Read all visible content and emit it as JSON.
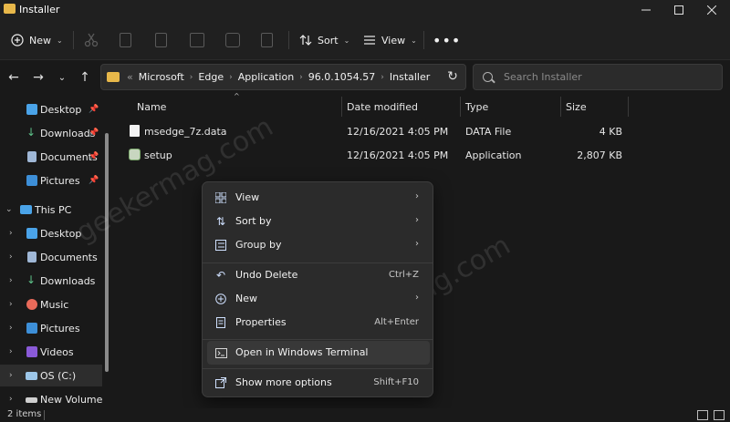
{
  "window": {
    "title": "Installer"
  },
  "commandbar": {
    "new_label": "New",
    "sort_label": "Sort",
    "view_label": "View"
  },
  "address": {
    "overflow": "«",
    "crumbs": [
      "Microsoft",
      "Edge",
      "Application",
      "96.0.1054.57",
      "Installer"
    ]
  },
  "search": {
    "placeholder": "Search Installer"
  },
  "sidebar": {
    "quick": [
      "Desktop",
      "Downloads",
      "Documents",
      "Pictures"
    ],
    "this_pc": "This PC",
    "pc_items": [
      "Desktop",
      "Documents",
      "Downloads",
      "Music",
      "Pictures",
      "Videos",
      "OS (C:)",
      "New Volume (D"
    ]
  },
  "columns": {
    "name": "Name",
    "date": "Date modified",
    "type": "Type",
    "size": "Size"
  },
  "files": [
    {
      "name": "msedge_7z.data",
      "date": "12/16/2021 4:05 PM",
      "type": "DATA File",
      "size": "4 KB"
    },
    {
      "name": "setup",
      "date": "12/16/2021 4:05 PM",
      "type": "Application",
      "size": "2,807 KB"
    }
  ],
  "context_menu": {
    "view": "View",
    "sort_by": "Sort by",
    "group_by": "Group by",
    "undo_delete": "Undo Delete",
    "undo_shortcut": "Ctrl+Z",
    "new": "New",
    "properties": "Properties",
    "properties_shortcut": "Alt+Enter",
    "open_terminal": "Open in Windows Terminal",
    "show_more": "Show more options",
    "show_more_shortcut": "Shift+F10"
  },
  "status": {
    "items": "2 items"
  },
  "watermark": {
    "text": "geekermag.com"
  }
}
